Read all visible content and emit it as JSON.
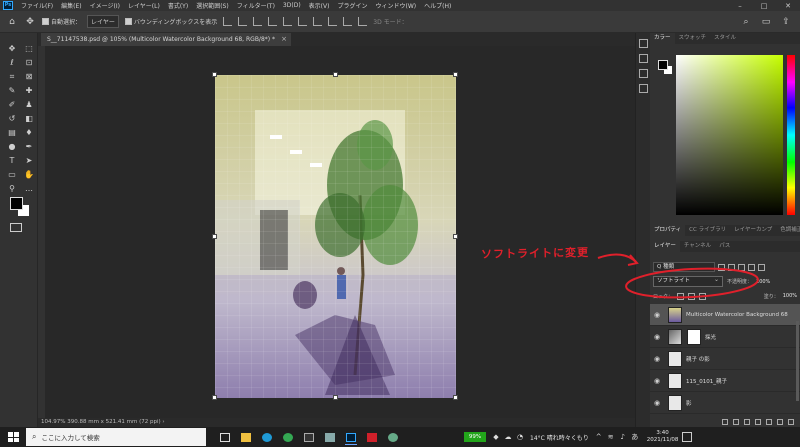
{
  "menubar": {
    "logo": "Ps",
    "items": [
      "ファイル(F)",
      "編集(E)",
      "イメージ(I)",
      "レイヤー(L)",
      "書式(Y)",
      "選択範囲(S)",
      "フィルター(T)",
      "3D(D)",
      "表示(V)",
      "プラグイン",
      "ウィンドウ(W)",
      "ヘルプ(H)"
    ],
    "window_controls": [
      "–",
      "□",
      "✕"
    ]
  },
  "options": {
    "auto_select_label": "自動選択：",
    "auto_select_value": "レイヤー",
    "bbox_label": "バウンディングボックスを表示",
    "mode_3d": "3D モード："
  },
  "document": {
    "tab_title": "S__71147538.psd @ 105% (Multicolor Watercolor Background 68, RGB/8*) *",
    "close": "×",
    "status": "104.97%   390.88 mm x 521.41 mm (72 ppi)   ›"
  },
  "annotation": {
    "text": "ソフトライトに変更",
    "color": "#e0202b"
  },
  "panels": {
    "color_tabs": [
      "カラー",
      "スウォッチ",
      "スタイル"
    ],
    "props_tabs": [
      "プロパティ",
      "CC ライブラリ",
      "レイヤーカンプ",
      "色調補正"
    ],
    "layer_tabs": [
      "レイヤー",
      "チャンネル",
      "パス"
    ],
    "kind_label": "Q 種類",
    "blend_mode": "ソフトライト",
    "opacity_label": "不透明度：",
    "opacity_value": "100%",
    "lock_label": "ロック：",
    "fill_label": "塗り：",
    "fill_value": "100%",
    "layers": [
      {
        "name": "Multicolor Watercolor Background 68",
        "thumb": "img",
        "selected": true,
        "mask": false
      },
      {
        "name": "採光",
        "thumb": "grad",
        "selected": false,
        "mask": true
      },
      {
        "name": "親子 の影",
        "thumb": "plain",
        "selected": false,
        "mask": false
      },
      {
        "name": "115_0101_親子",
        "thumb": "plain",
        "selected": false,
        "mask": false
      },
      {
        "name": "影",
        "thumb": "plain",
        "selected": false,
        "mask": false
      }
    ]
  },
  "taskbar": {
    "search_placeholder": "ここに入力して検索",
    "battery": "99%",
    "weather": "14°C 晴れ時々くもり",
    "time": "3:40",
    "date": "2021/11/08"
  },
  "colors": {
    "accent_red": "#e0202b",
    "panel_bg": "#323232",
    "canvas_bg": "#282828"
  }
}
